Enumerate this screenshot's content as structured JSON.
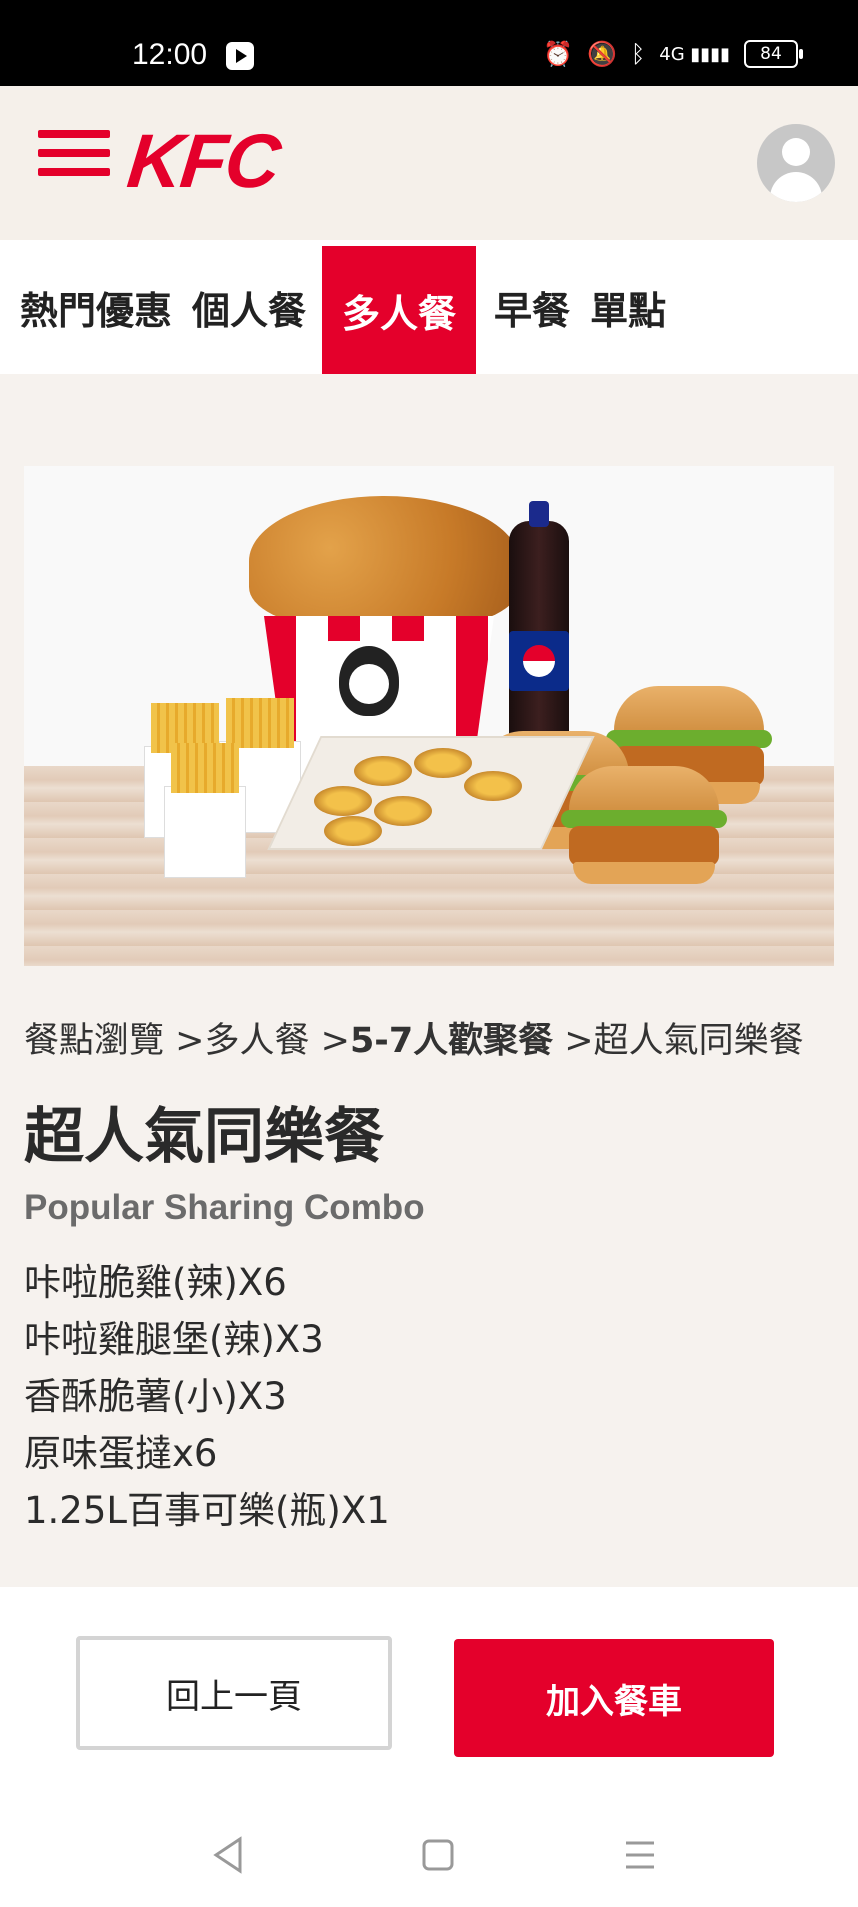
{
  "status_bar": {
    "time": "12:00",
    "battery": "84",
    "network": "4G"
  },
  "header": {
    "logo_text": "KFC"
  },
  "tabs": [
    {
      "label": "熱門優惠",
      "active": false
    },
    {
      "label": "個人餐",
      "active": false
    },
    {
      "label": "多人餐",
      "active": true
    },
    {
      "label": "早餐",
      "active": false
    },
    {
      "label": "單點",
      "active": false
    }
  ],
  "breadcrumb": {
    "root": "餐點瀏覽",
    "level1": "多人餐",
    "level2": "5-7人歡聚餐",
    "current": "超人氣同樂餐",
    "separator": " >"
  },
  "product": {
    "title": "超人氣同樂餐",
    "subtitle": "Popular Sharing Combo",
    "items": [
      "咔啦脆雞(辣)X6",
      "咔啦雞腿堡(辣)X3",
      "香酥脆薯(小)X3",
      "原味蛋撻x6",
      "1.25L百事可樂(瓶)X1"
    ]
  },
  "actions": {
    "back_label": "回上一頁",
    "cart_label": "加入餐車"
  },
  "colors": {
    "brand_red": "#e4002b",
    "background": "#f6f2ee"
  }
}
